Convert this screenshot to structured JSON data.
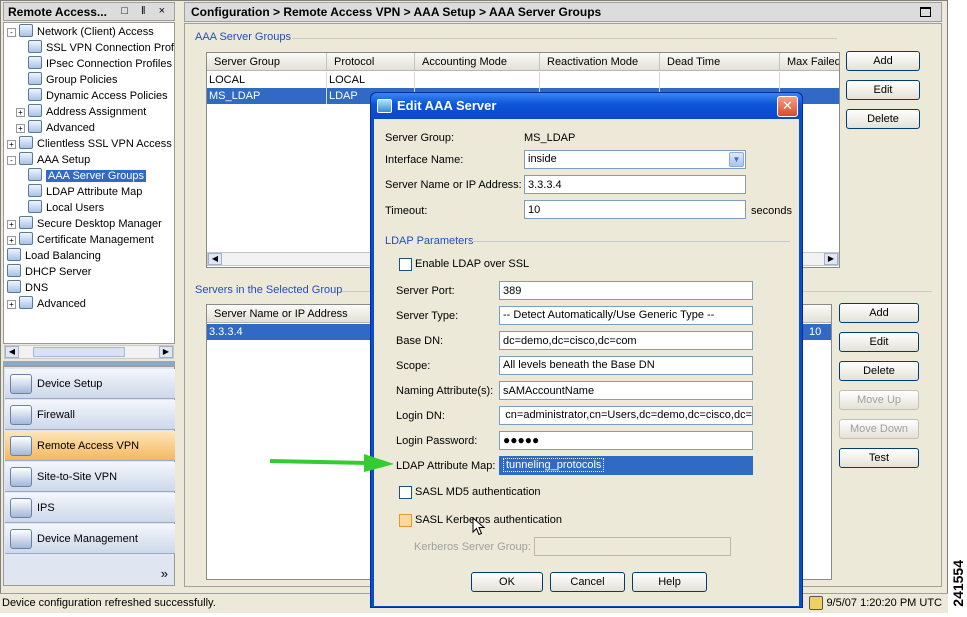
{
  "left_panel": {
    "title": "Remote Access...",
    "title_icons": "□ ‖ ×",
    "tree": [
      {
        "label": "Network (Client) Access",
        "indent": 1,
        "exp": "-"
      },
      {
        "label": "SSL VPN Connection Profiles",
        "indent": 3,
        "exp": ""
      },
      {
        "label": "IPsec Connection Profiles",
        "indent": 3,
        "exp": ""
      },
      {
        "label": "Group Policies",
        "indent": 3,
        "exp": ""
      },
      {
        "label": "Dynamic Access Policies",
        "indent": 3,
        "exp": ""
      },
      {
        "label": "Address Assignment",
        "indent": 2,
        "exp": "+"
      },
      {
        "label": "Advanced",
        "indent": 2,
        "exp": "+"
      },
      {
        "label": "Clientless SSL VPN Access",
        "indent": 1,
        "exp": "+"
      },
      {
        "label": "AAA Setup",
        "indent": 1,
        "exp": "-"
      },
      {
        "label": "AAA Server Groups",
        "indent": 3,
        "exp": "",
        "selected": true
      },
      {
        "label": "LDAP Attribute Map",
        "indent": 3,
        "exp": ""
      },
      {
        "label": "Local Users",
        "indent": 3,
        "exp": ""
      },
      {
        "label": "Secure Desktop Manager",
        "indent": 1,
        "exp": "+"
      },
      {
        "label": "Certificate Management",
        "indent": 1,
        "exp": "+"
      },
      {
        "label": "Load Balancing",
        "indent": 1,
        "exp": ""
      },
      {
        "label": "DHCP Server",
        "indent": 1,
        "exp": ""
      },
      {
        "label": "DNS",
        "indent": 1,
        "exp": ""
      },
      {
        "label": "Advanced",
        "indent": 1,
        "exp": "+"
      }
    ],
    "nav_buttons": [
      {
        "label": "Device Setup",
        "name": "device-setup",
        "active": false
      },
      {
        "label": "Firewall",
        "name": "firewall",
        "active": false
      },
      {
        "label": "Remote Access VPN",
        "name": "remote-access-vpn",
        "active": true
      },
      {
        "label": "Site-to-Site VPN",
        "name": "site-to-site-vpn",
        "active": false
      },
      {
        "label": "IPS",
        "name": "ips",
        "active": false
      },
      {
        "label": "Device Management",
        "name": "device-management",
        "active": false
      }
    ],
    "more_glyph": "»"
  },
  "config": {
    "breadcrumb": "Configuration > Remote Access VPN > AAA Setup > AAA Server Groups",
    "server_groups": {
      "label": "AAA Server Groups",
      "columns": [
        "Server Group",
        "Protocol",
        "Accounting Mode",
        "Reactivation Mode",
        "Dead Time",
        "Max Failed"
      ],
      "rows": [
        [
          "LOCAL",
          "LOCAL"
        ],
        [
          "MS_LDAP",
          "LDAP"
        ]
      ],
      "selected_row": 1,
      "buttons": {
        "add": "Add",
        "edit": "Edit",
        "delete": "Delete"
      }
    },
    "servers": {
      "label": "Servers in the Selected Group",
      "columns": [
        "Server Name or IP Address"
      ],
      "rows": [
        [
          "3.3.3.4",
          "10"
        ]
      ],
      "buttons": {
        "add": "Add",
        "edit": "Edit",
        "delete": "Delete",
        "move_up": "Move Up",
        "move_down": "Move Down",
        "test": "Test"
      }
    }
  },
  "dialog": {
    "title": "Edit AAA Server",
    "close_glyph": "✕",
    "server_group_label": "Server Group:",
    "server_group_value": "MS_LDAP",
    "interface_label": "Interface Name:",
    "interface_value": "inside",
    "server_name_label": "Server Name or IP Address:",
    "server_name_value": "3.3.3.4",
    "timeout_label": "Timeout:",
    "timeout_value": "10",
    "timeout_unit": "seconds",
    "ldap_params_label": "LDAP Parameters",
    "enable_ssl_label": "Enable LDAP over SSL",
    "server_port_label": "Server Port:",
    "server_port_value": "389",
    "server_type_label": "Server Type:",
    "server_type_value": "-- Detect Automatically/Use Generic Type --",
    "base_dn_label": "Base DN:",
    "base_dn_value": "dc=demo,dc=cisco,dc=com",
    "scope_label": "Scope:",
    "scope_value": "All levels beneath the Base DN",
    "naming_attr_label": "Naming Attribute(s):",
    "naming_attr_value": "sAMAccountName",
    "login_dn_label": "Login DN:",
    "login_dn_value": "cn=administrator,cn=Users,dc=demo,dc=cisco,dc=",
    "login_password_label": "Login Password:",
    "login_password_value": "●●●●●",
    "ldap_map_label": "LDAP Attribute Map:",
    "ldap_map_value": "tunneling_protocols",
    "sasl_md5_label": "SASL MD5 authentication",
    "sasl_kerberos_label": "SASL Kerberos authentication",
    "kerberos_group_label": "Kerberos Server Group:",
    "kerberos_group_value": "",
    "ok": "OK",
    "cancel": "Cancel",
    "help": "Help"
  },
  "status": {
    "message": "Device configuration refreshed successfully.",
    "timestamp": "9/5/07 1:20:20 PM UTC"
  },
  "figure_id": "241554",
  "colors": {
    "selection": "#316ac5",
    "dialog_title": "#0a4ccc",
    "group_label": "#1f4fbf",
    "arrow": "#33cc33",
    "active_nav": "#f5b860"
  }
}
